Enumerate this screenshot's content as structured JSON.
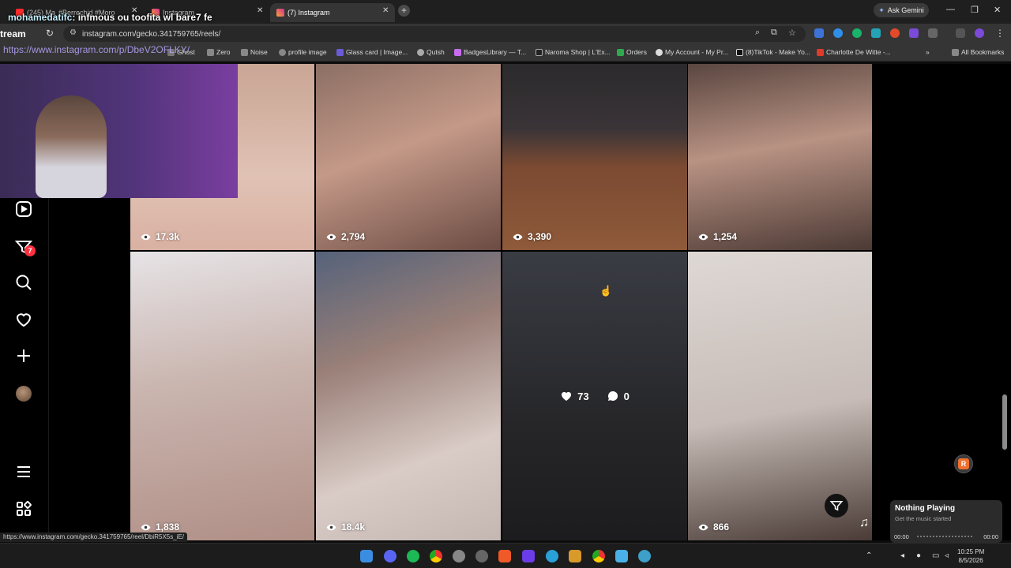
{
  "browser": {
    "tabs": [
      {
        "label": "(245) Ma",
        "icon": "youtube-icon"
      },
      {
        "label": "#Berrechid #Moro",
        "icon": "tiktok-icon"
      },
      {
        "label": "Instagram",
        "icon": "instagram-icon"
      },
      {
        "label": "(7) Instagram",
        "icon": "instagram-icon",
        "active": true
      }
    ],
    "ask_gemini": "Ask Gemini",
    "url": "instagram.com/gecko.341759765/reels/",
    "bookmarks": [
      "Ghost",
      "Zero",
      "Noise",
      "profile image",
      "Glass card | Image...",
      "Qutsh",
      "BadgesLibrary — T...",
      "Naroma Shop | L'Ex...",
      "Orders",
      "My Account - My Pr...",
      "(8)TikTok - Make Yo...",
      "Charlotte De Witte -..."
    ],
    "all_bookmarks": "All Bookmarks",
    "status_url": "https://www.instagram.com/gecko.341759765/reel/DbiR5X5s_iE/"
  },
  "stream_overlay": {
    "chat_user": "mohamedatifc",
    "chat_message": ": infmous ou toofita wl bare7 fe",
    "overlay_url": "https://www.instagram.com/p/DbeV2OFLKY/",
    "stream_label": "tream"
  },
  "sidebar": {
    "notification_count": "7",
    "icons": [
      "reels-icon",
      "filter-heart-icon",
      "search-icon",
      "heart-icon",
      "create-icon",
      "profile-avatar",
      "menu-icon",
      "apps-icon"
    ]
  },
  "reels": [
    {
      "views": "17.3k"
    },
    {
      "views": "2,794"
    },
    {
      "views": "3,390"
    },
    {
      "views": "1,254"
    },
    {
      "views": "1,838"
    },
    {
      "views": "18.4k"
    },
    {
      "likes": "73",
      "comments": "0"
    },
    {
      "views": "866"
    }
  ],
  "music": {
    "title": "Nothing Playing",
    "subtitle": "Get the music started",
    "time_start": "00:00",
    "time_end": "00:00"
  },
  "taskbar": {
    "time": "10:25 PM",
    "date": "8/5/2026"
  },
  "colors": {
    "accent_badge": "#ff3040",
    "page_background": "#000000",
    "browser_chrome": "#353535"
  }
}
